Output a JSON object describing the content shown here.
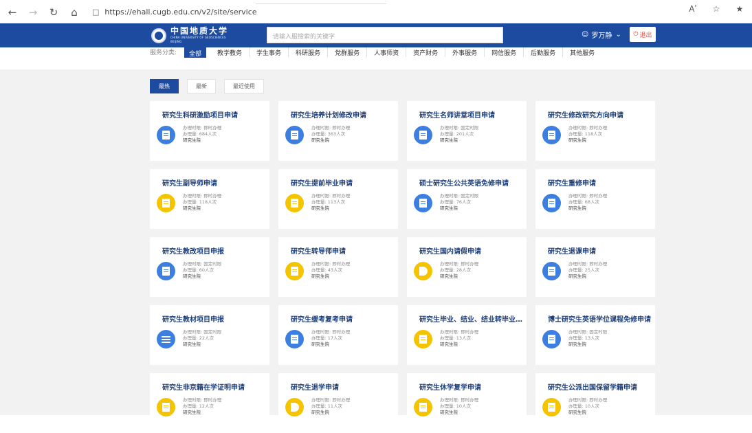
{
  "browser": {
    "url": "https://ehall.cugb.edu.cn/v2/site/service",
    "icons": [
      "back-arrow",
      "forward-arrow",
      "refresh",
      "home",
      "lock",
      "read-aloud",
      "add-favorite",
      "favorites"
    ],
    "read_aloud_glyph": "Aʹ",
    "favorite_glyph": "☆",
    "favorites_glyph": "★"
  },
  "header": {
    "logo_cn": "中国地质大学",
    "logo_en": "CHINA UNIVERSITY OF GEOSCIENCES",
    "logo_en_sub": "BEIJING",
    "search_placeholder": "请输入服搜索的关键字",
    "user_name": "罗万静",
    "logout_label": "退出",
    "colors": {
      "brand": "#1d4ba0",
      "logout": "#e74c3c"
    }
  },
  "categories": {
    "label": "服务分类:",
    "items": [
      "全部",
      "教学教务",
      "学生事务",
      "科研服务",
      "党群服务",
      "人事师资",
      "资产财务",
      "外事服务",
      "网信服务",
      "后勤服务",
      "其他服务"
    ],
    "active": "全部"
  },
  "sort_tabs": {
    "items": [
      "最热",
      "最新",
      "最近使用"
    ],
    "active": "最热"
  },
  "labels": {
    "time_prefix": "办理时限:",
    "count_prefix": "办理量:"
  },
  "services": [
    {
      "title": "研究生科研激励项目申请",
      "time": "即时办理",
      "count": "684人次",
      "dept": "研究生院",
      "icon": "clipboard-icon",
      "color": "blue"
    },
    {
      "title": "研究生培养计划修改申请",
      "time": "即时办理",
      "count": "363人次",
      "dept": "研究生院",
      "icon": "document-icon",
      "color": "blue"
    },
    {
      "title": "研究生名师讲堂项目申请",
      "time": "固定时限",
      "count": "201人次",
      "dept": "研究生院",
      "icon": "clipboard-icon",
      "color": "blue"
    },
    {
      "title": "研究生修改研究方向申请",
      "time": "即时办理",
      "count": "118人次",
      "dept": "研究生院",
      "icon": "clipboard-icon",
      "color": "blue"
    },
    {
      "title": "研究生副导师申请",
      "time": "即时办理",
      "count": "118人次",
      "dept": "研究生院",
      "icon": "note-icon",
      "color": "yellow"
    },
    {
      "title": "研究生提前毕业申请",
      "time": "即时办理",
      "count": "113人次",
      "dept": "研究生院",
      "icon": "clipboard-icon",
      "color": "yellow"
    },
    {
      "title": "硕士研究生公共英语免修申请",
      "time": "固定时限",
      "count": "76人次",
      "dept": "研究生院",
      "icon": "document-icon",
      "color": "blue"
    },
    {
      "title": "研究生重修申请",
      "time": "即时办理",
      "count": "68人次",
      "dept": "研究生院",
      "icon": "edit-icon",
      "color": "blue"
    },
    {
      "title": "研究生教改项目申报",
      "time": "固定时限",
      "count": "60人次",
      "dept": "研究生院",
      "icon": "edit-icon",
      "color": "blue"
    },
    {
      "title": "研究生转导师申请",
      "time": "即时办理",
      "count": "43人次",
      "dept": "研究生院",
      "icon": "clipboard-icon",
      "color": "yellow"
    },
    {
      "title": "研究生国内请假申请",
      "time": "即时办理",
      "count": "28人次",
      "dept": "研究生院",
      "icon": "pie-icon",
      "color": "yellow"
    },
    {
      "title": "研究生退课申请",
      "time": "即时办理",
      "count": "25人次",
      "dept": "研究生院",
      "icon": "note-icon",
      "color": "blue"
    },
    {
      "title": "研究生教材项目申报",
      "time": "固定时限",
      "count": "22人次",
      "dept": "研究生院",
      "icon": "list-icon",
      "color": "blue"
    },
    {
      "title": "研究生缓考复考申请",
      "time": "即时办理",
      "count": "17人次",
      "dept": "研究生院",
      "icon": "cursor-icon",
      "color": "blue"
    },
    {
      "title": "研究生毕业、结业、结业转毕业...",
      "time": "即时办理",
      "count": "13人次",
      "dept": "研究生院",
      "icon": "document-icon",
      "color": "yellow"
    },
    {
      "title": "博士研究生英语学位课程免修申请",
      "time": "固定时限",
      "count": "13人次",
      "dept": "研究生院",
      "icon": "clipboard-icon",
      "color": "blue"
    },
    {
      "title": "研究生非京籍在学证明申请",
      "time": "即时办理",
      "count": "12人次",
      "dept": "研究生院",
      "icon": "note-icon",
      "color": "yellow"
    },
    {
      "title": "研究生退学申请",
      "time": "即时办理",
      "count": "11人次",
      "dept": "研究生院",
      "icon": "pie-icon",
      "color": "yellow"
    },
    {
      "title": "研究生休学复学申请",
      "time": "即时办理",
      "count": "10人次",
      "dept": "研究生院",
      "icon": "document-icon",
      "color": "yellow"
    },
    {
      "title": "研究生公派出国保留学籍申请",
      "time": "即时办理",
      "count": "10人次",
      "dept": "研究生院",
      "icon": "calendar-icon",
      "color": "yellow"
    }
  ]
}
